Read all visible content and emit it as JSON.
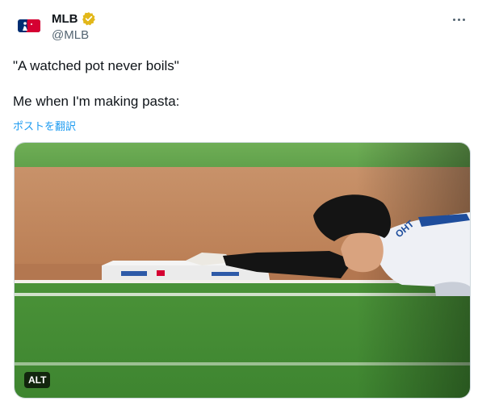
{
  "account": {
    "display_name": "MLB",
    "handle": "@MLB",
    "verified_color": "#e2b719"
  },
  "post": {
    "text_lines": [
      "\"A watched pot never boils\"",
      "",
      "Me when I'm making pasta:"
    ],
    "translate_label": "ポストを翻訳"
  },
  "media": {
    "alt_label": "ALT",
    "colors": {
      "grass": "#4f9a3e",
      "dirt": "#c0855b",
      "base": "#f4f4f4",
      "jersey": "#eef0f5",
      "jersey_accent": "#1e4d9c"
    }
  },
  "icons": {
    "more": "more-horizontal-icon",
    "verified": "verified-badge-icon",
    "avatar": "mlb-logo-icon"
  }
}
